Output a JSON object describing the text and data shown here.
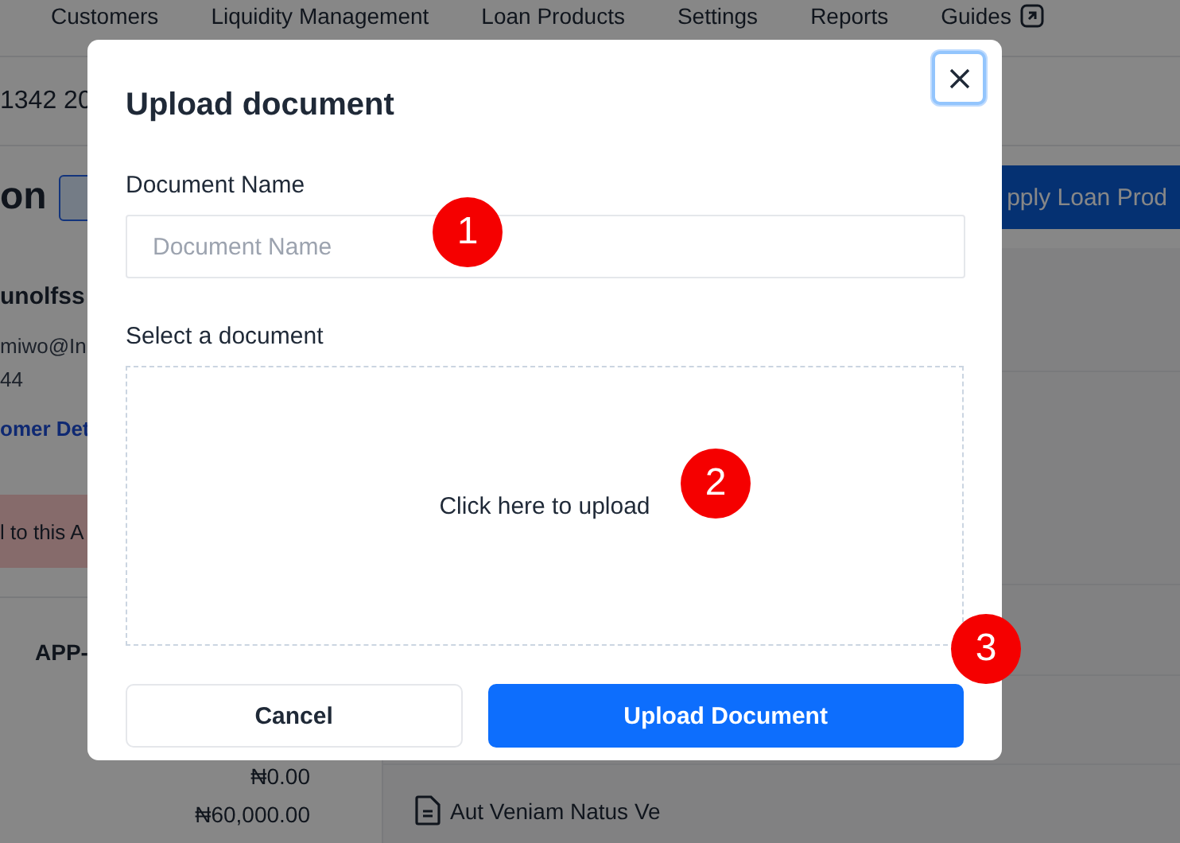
{
  "nav": {
    "items": [
      "Customers",
      "Liquidity Management",
      "Loan Products",
      "Settings",
      "Reports",
      "Guides"
    ]
  },
  "page": {
    "header_text": "1342 20",
    "title": "on",
    "apply_button": "pply Loan Prod",
    "customer": {
      "name": "unolfss",
      "email": "miwo@In",
      "phone": "44",
      "link": "omer Det"
    },
    "alert": "l to this A",
    "application_id": "APP-",
    "amounts": [
      "₦0.00",
      "₦60,000.00"
    ],
    "document": "Aut Veniam Natus Ve"
  },
  "dialog": {
    "title": "Upload document",
    "name_label": "Document Name",
    "name_placeholder": "Document Name",
    "select_label": "Select a document",
    "dropzone_text": "Click here to upload",
    "cancel_button": "Cancel",
    "upload_button": "Upload Document"
  },
  "annotations": [
    {
      "label": "1"
    },
    {
      "label": "2"
    },
    {
      "label": "3"
    }
  ]
}
